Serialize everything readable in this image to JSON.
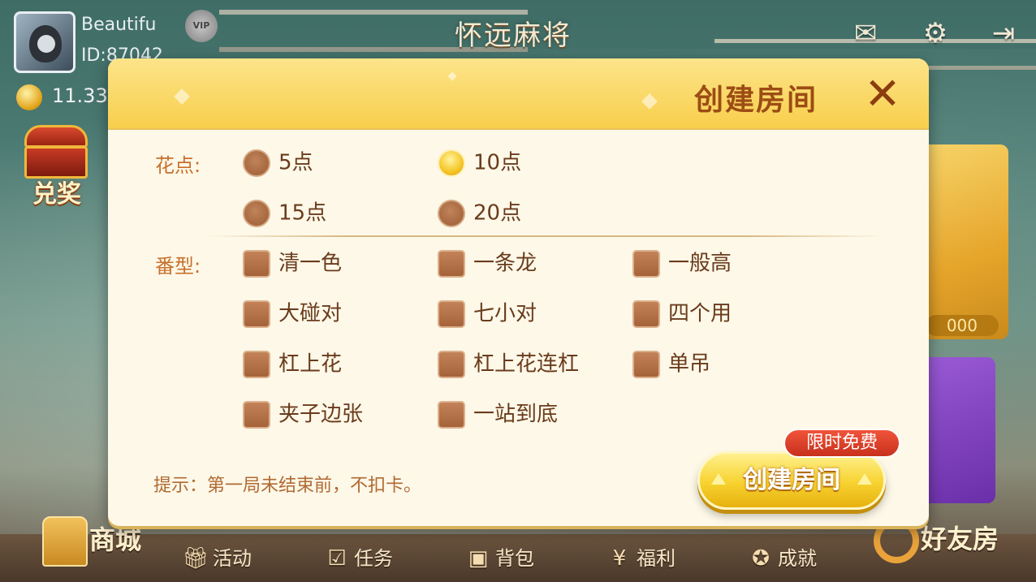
{
  "user": {
    "name": "Beautifu",
    "id": "ID:87042",
    "coins": "11.33",
    "vip": "VIP"
  },
  "header": {
    "title": "怀远麻将"
  },
  "top_icons": [
    "mail-icon",
    "gear-icon",
    "exit-icon"
  ],
  "side": {
    "redeem_label": "兑奖",
    "gold_card_amount": "000"
  },
  "dialog": {
    "title": "创建房间",
    "close_icon": "✕",
    "flower": {
      "label": "花点:",
      "options": [
        {
          "label": "5点",
          "selected": false
        },
        {
          "label": "10点",
          "selected": true
        },
        {
          "label": "15点",
          "selected": false
        },
        {
          "label": "20点",
          "selected": false
        }
      ]
    },
    "fan": {
      "label": "番型:",
      "options": [
        "清一色",
        "一条龙",
        "一般高",
        "大碰对",
        "七小对",
        "四个用",
        "杠上花",
        "杠上花连杠",
        "单吊",
        "夹子边张",
        "一站到底"
      ]
    },
    "tip": "提示：第一局未结束前，不扣卡。",
    "create_button": "创建房间",
    "free_badge": "限时免费"
  },
  "bottom_nav": {
    "shop": "商城",
    "activity": "活动",
    "task": "任务",
    "bag": "背包",
    "welfare": "福利",
    "achievement": "成就",
    "friend_room": "好友房"
  },
  "colors": {
    "accent": "#f8cf4c",
    "title": "#9c4c14",
    "label": "#c8702c",
    "panel": "#fdf8e8"
  }
}
